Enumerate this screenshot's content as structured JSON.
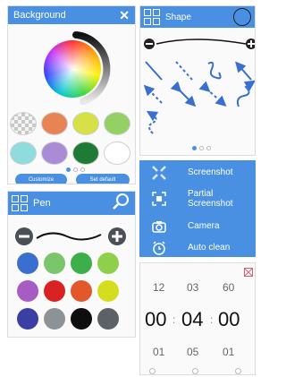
{
  "background_panel": {
    "title": "Background",
    "close_icon": "close-icon",
    "swatches": [
      "transparent",
      "#e88454",
      "#d7e047",
      "#94d063",
      "#8fdcdf",
      "#a98bd6",
      "#1f7a35",
      "#ffffff"
    ],
    "buttons": {
      "customize": "Customize",
      "set_default": "Set default"
    },
    "page_count": 3,
    "active_page": 1
  },
  "shape_panel": {
    "title": "Shape",
    "shape_icons": [
      "line-icon",
      "dashed-line-icon",
      "freehand-icon",
      "arrow-icon",
      "dashed-arrow-icon",
      "double-arrow-icon",
      "dashed-double-arrow-icon",
      "freehand-arrow-icon",
      "freehand-dashed-arrow-icon"
    ],
    "page_count": 3,
    "active_page": 1
  },
  "pen_panel": {
    "title": "Pen",
    "colors": [
      "#3b6fcf",
      "#7bc56a",
      "#3cae4a",
      "#8fcf4a",
      "#a65cc3",
      "#d92222",
      "#e2582a",
      "#d4de1f",
      "#3b3fa3",
      "#8d9297",
      "#0e0e0e",
      "#5b6166"
    ]
  },
  "capture_menu": {
    "items": [
      {
        "label": "Screenshot",
        "icon": "screenshot-icon"
      },
      {
        "label": "Partial Screenshot",
        "icon": "partial-screenshot-icon"
      },
      {
        "label": "Camera",
        "icon": "camera-icon"
      },
      {
        "label": "Auto clean",
        "icon": "alarm-icon"
      }
    ]
  },
  "timer_panel": {
    "prev": [
      "12",
      "03",
      "60"
    ],
    "current": [
      "00",
      "04",
      "00"
    ],
    "next": [
      "01",
      "05",
      "01"
    ],
    "separator": ":"
  }
}
